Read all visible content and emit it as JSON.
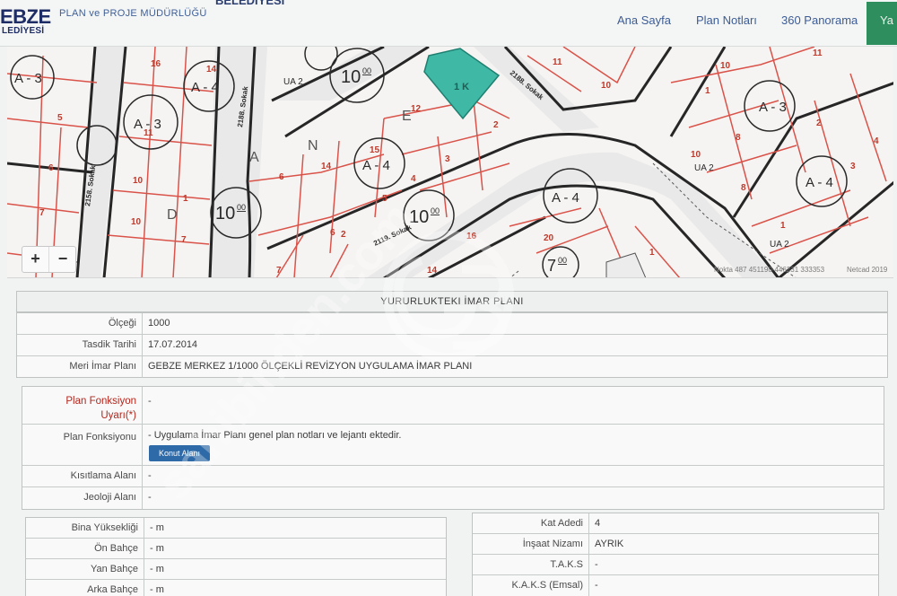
{
  "header": {
    "logo_top": "GEBZE",
    "logo_main": "EBZE",
    "logo_sub": "LEDİYESİ",
    "department": "PLAN ve PROJE MÜDÜRLÜĞÜ",
    "nav": [
      "Ana Sayfa",
      "Plan Notları",
      "360 Panorama"
    ],
    "nav_extra": "Ya"
  },
  "map": {
    "zoom_in": "+",
    "zoom_out": "−",
    "scale_text": "Nokta 487 451190-446231 333353",
    "attribution": "Netcad 2019",
    "labels": {
      "block_1": "A - 3",
      "block_2": "A - 4",
      "block_3": "A - 3",
      "block_4": "A - 4",
      "block_5": "A - 4",
      "block_6": "A - 3",
      "block_7": "A - 4",
      "h10a": "10",
      "h10a_sup": "00",
      "h10b": "10",
      "h10b_sup": "00",
      "h10c": "10",
      "h10c_sup": "00",
      "h7": "7",
      "h7_sup": "00",
      "ua_1": "UA 2",
      "ua_2": "UA 2",
      "ua_3": "UA 2",
      "street_1": "2188. Sokak",
      "street_2": "2158. Sokak",
      "street_3": "2119. Sokak",
      "street_4": "2188. Sokak",
      "parcel_1k": "1 K",
      "zone_letters": [
        "N",
        "E",
        "A",
        "D"
      ],
      "parcel_numbers": [
        "16",
        "14",
        "5",
        "11",
        "6",
        "10",
        "7",
        "10",
        "1",
        "7",
        "15",
        "12",
        "14",
        "4",
        "5",
        "6",
        "3",
        "2",
        "2",
        "11",
        "10",
        "10",
        "1",
        "10",
        "8",
        "2",
        "3",
        "4",
        "1",
        "8",
        "14",
        "16",
        "20",
        "11",
        "7",
        "6",
        "1"
      ]
    }
  },
  "plan": {
    "title": "YURURLUKTEKI İMAR PLANI",
    "rows": [
      {
        "label": "Ölçeği",
        "value": "1000"
      },
      {
        "label": "Tasdik Tarihi",
        "value": "17.07.2014"
      },
      {
        "label": "Meri İmar Planı",
        "value": "GEBZE MERKEZ 1/1000 ÖLÇEKLİ REVİZYON UYGULAMA İMAR PLANI"
      }
    ]
  },
  "function": {
    "warning_label": "Plan Fonksiyon Uyarı(*)",
    "warning_value": "-",
    "function_label": "Plan Fonksiyonu",
    "function_value": "- Uygulama İmar Planı genel plan notları ve lejantı ektedir.",
    "button": "Konut Alanı",
    "restriction_label": "Kısıtlama Alanı",
    "restriction_value": "-",
    "geology_label": "Jeoloji Alanı",
    "geology_value": "-"
  },
  "building_left": [
    {
      "label": "Bina Yüksekliği",
      "value": "- m"
    },
    {
      "label": "Ön Bahçe",
      "value": "- m"
    },
    {
      "label": "Yan Bahçe",
      "value": "- m"
    },
    {
      "label": "Arka Bahçe",
      "value": "- m"
    }
  ],
  "building_right": [
    {
      "label": "Kat Adedi",
      "value": "4"
    },
    {
      "label": "İnşaat Nizamı",
      "value": "AYRIK"
    },
    {
      "label": "T.A.K.S",
      "value": "-"
    },
    {
      "label": "K.A.K.S (Emsal)",
      "value": "-"
    }
  ],
  "colors": {
    "brand": "#1f2d66",
    "nav": "#3d5c95",
    "parcel_line": "#d9534a",
    "road": "#2a2a2a",
    "selected_parcel": "#3fb8a6",
    "button": "#2f6aa8",
    "warning": "#b5261e"
  },
  "icons": [
    "zoom-in-icon",
    "zoom-out-icon"
  ],
  "watermark": "sahibinden.com"
}
